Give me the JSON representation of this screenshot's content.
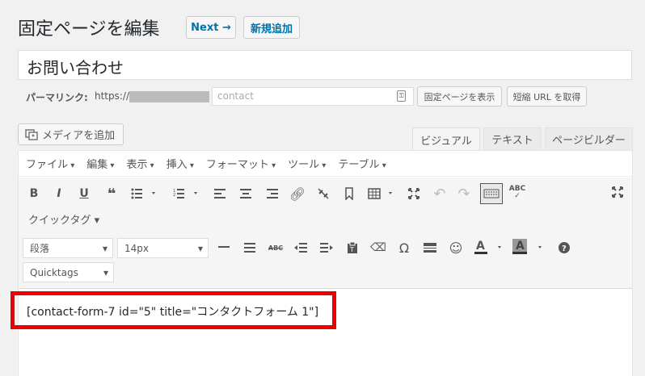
{
  "header": {
    "title": "固定ページを編集",
    "next_label": "Next →",
    "new_label": "新規追加"
  },
  "post": {
    "title": "お問い合わせ"
  },
  "permalink": {
    "label": "パーマリンク:",
    "base": "https://",
    "slug_placeholder": "contact",
    "view_button": "固定ページを表示",
    "shorturl_button": "短縮 URL を取得"
  },
  "editor": {
    "media_button": "メディアを追加",
    "tabs": [
      "ビジュアル",
      "テキスト",
      "ページビルダー"
    ],
    "menus": [
      "ファイル",
      "編集",
      "表示",
      "挿入",
      "フォーマット",
      "ツール",
      "テーブル"
    ],
    "quicktag_label": "クイックタグ",
    "format_select": "段落",
    "fontsize_select": "14px",
    "quicktags_select": "Quicktags",
    "content": "[contact-form-7 id=\"5\" title=\"コンタクトフォーム 1\"]"
  },
  "colors": {
    "accent": "#0073aa",
    "highlight": "#e00000"
  }
}
